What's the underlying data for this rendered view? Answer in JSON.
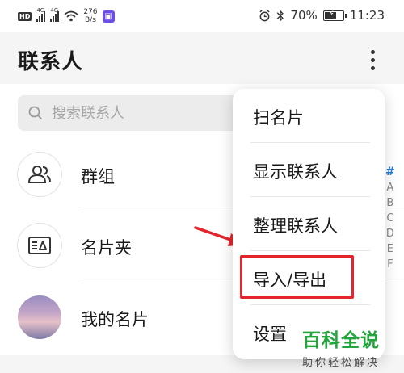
{
  "status_bar": {
    "hd_label": "HD",
    "signal1_label": "4G",
    "signal2_label": "4G",
    "speed_value": "276",
    "speed_unit": "B/s",
    "battery_percent": "70%",
    "battery_level": 0.7,
    "time": "11:23"
  },
  "header": {
    "title": "联系人"
  },
  "search": {
    "placeholder": "搜索联系人"
  },
  "list": {
    "items": [
      {
        "label": "群组",
        "icon": "group-icon"
      },
      {
        "label": "名片夹",
        "icon": "business-card-icon"
      },
      {
        "label": "我的名片",
        "icon": "avatar"
      }
    ]
  },
  "alphabet_index": [
    "#",
    "A",
    "B",
    "C",
    "D",
    "E",
    "F"
  ],
  "menu": {
    "items": [
      {
        "label": "扫名片"
      },
      {
        "label": "显示联系人"
      },
      {
        "label": "整理联系人"
      },
      {
        "label": "导入/导出"
      },
      {
        "label": "设置"
      }
    ]
  },
  "watermark": {
    "title": "百科全说",
    "subtitle": "助你轻松解决"
  },
  "colors": {
    "highlight": "#e4262c",
    "watermark_green": "#22a53a",
    "index_accent": "#1e7be3"
  }
}
